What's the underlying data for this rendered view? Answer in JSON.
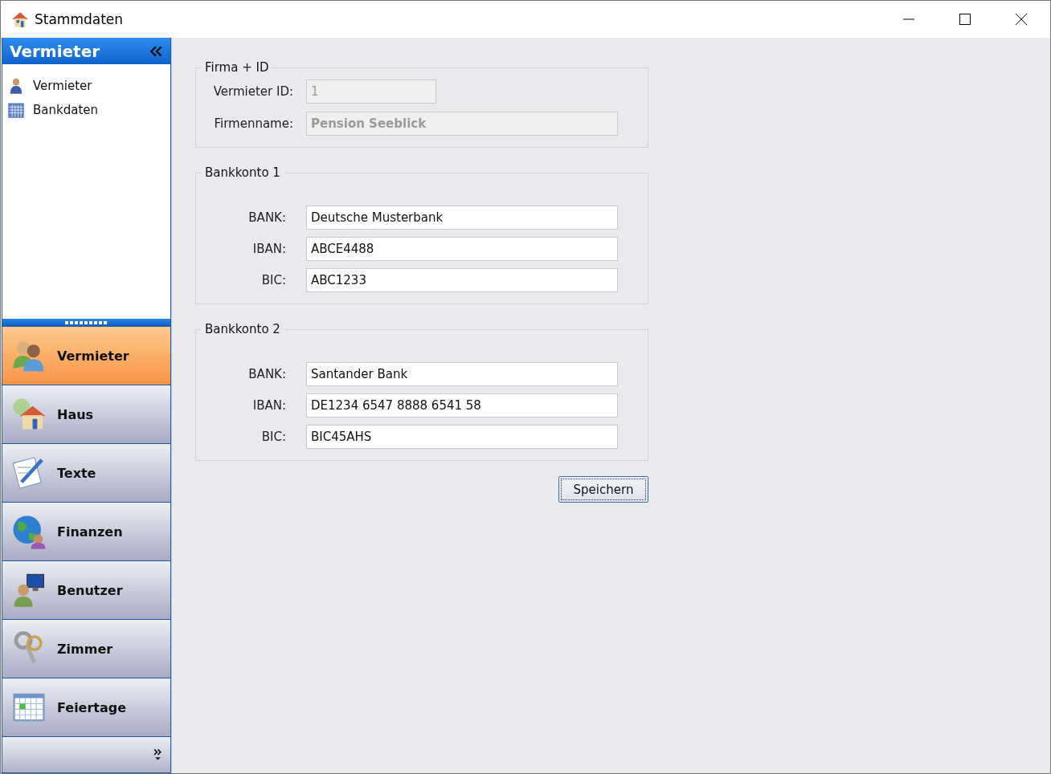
{
  "window": {
    "title": "Stammdaten"
  },
  "sidebar": {
    "header": "Vermieter",
    "items": [
      {
        "label": "Vermieter"
      },
      {
        "label": "Bankdaten"
      }
    ],
    "nav": [
      {
        "label": "Vermieter",
        "selected": true
      },
      {
        "label": "Haus",
        "selected": false
      },
      {
        "label": "Texte",
        "selected": false
      },
      {
        "label": "Finanzen",
        "selected": false
      },
      {
        "label": "Benutzer",
        "selected": false
      },
      {
        "label": "Zimmer",
        "selected": false
      },
      {
        "label": "Feiertage",
        "selected": false
      }
    ]
  },
  "groups": [
    {
      "title": "Firma + ID",
      "fields": [
        {
          "label": "Vermieter ID:",
          "value": "1",
          "disabled": true,
          "short": true,
          "bold": false
        },
        {
          "label": "Firmenname:",
          "value": "Pension Seeblick",
          "disabled": true,
          "short": false,
          "bold": true
        }
      ]
    },
    {
      "title": "Bankkonto 1",
      "fields": [
        {
          "label": "BANK:",
          "value": "Deutsche Musterbank",
          "disabled": false,
          "short": false,
          "bold": false
        },
        {
          "label": "IBAN:",
          "value": "ABCE4488",
          "disabled": false,
          "short": false,
          "bold": false
        },
        {
          "label": "BIC:",
          "value": "ABC1233",
          "disabled": false,
          "short": false,
          "bold": false
        }
      ]
    },
    {
      "title": "Bankkonto 2",
      "fields": [
        {
          "label": "BANK:",
          "value": "Santander Bank",
          "disabled": false,
          "short": false,
          "bold": false
        },
        {
          "label": "IBAN:",
          "value": "DE1234 6547 8888 6541 58",
          "disabled": false,
          "short": false,
          "bold": false
        },
        {
          "label": "BIC:",
          "value": "BIC45AHS",
          "disabled": false,
          "short": false,
          "bold": false
        }
      ]
    }
  ],
  "save_button": "Speichern"
}
